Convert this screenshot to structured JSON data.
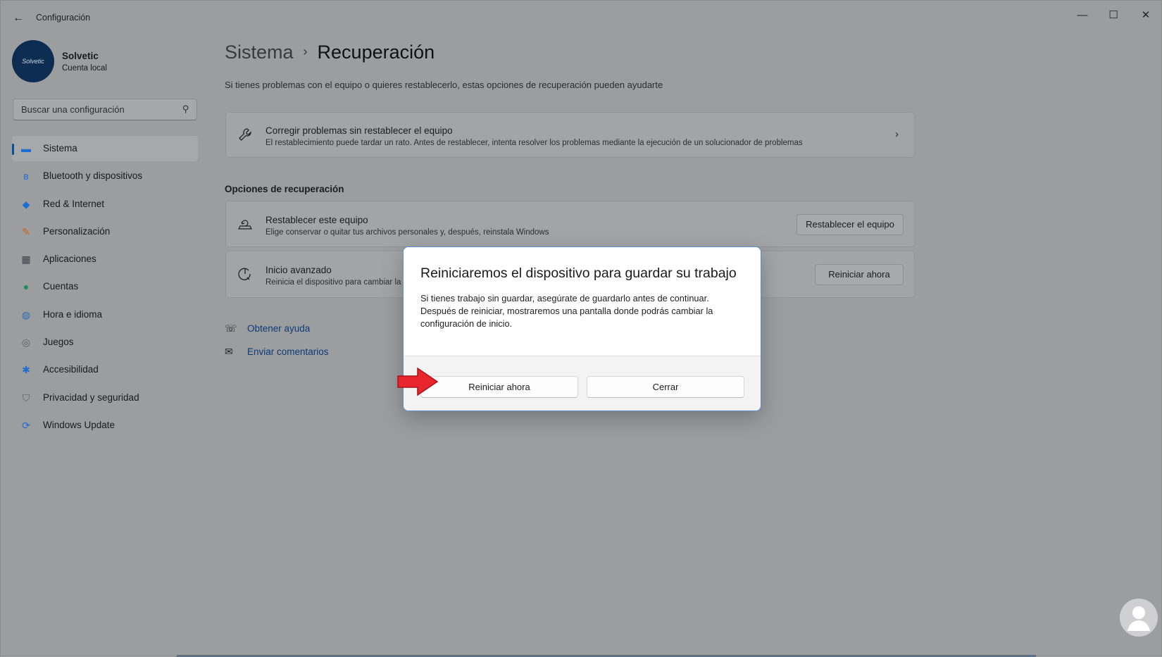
{
  "window": {
    "title": "Configuración",
    "back_glyph": "←",
    "controls": {
      "minimize": "—",
      "maximize": "☐",
      "close": "✕"
    }
  },
  "profile": {
    "avatar_text": "Solvetic",
    "name": "Solvetic",
    "account": "Cuenta local"
  },
  "search": {
    "placeholder": "Buscar una configuración",
    "icon": "search-icon"
  },
  "sidebar": {
    "items": [
      {
        "label": "Sistema",
        "icon": "monitor-icon",
        "glyph": "▬",
        "color": "#1c6fd1",
        "active": true
      },
      {
        "label": "Bluetooth y dispositivos",
        "icon": "bluetooth-icon",
        "glyph": "ʙ",
        "color": "#1c6fd1"
      },
      {
        "label": "Red & Internet",
        "icon": "wifi-icon",
        "glyph": "◆",
        "color": "#1c6fd1"
      },
      {
        "label": "Personalización",
        "icon": "brush-icon",
        "glyph": "✎",
        "color": "#c9621e"
      },
      {
        "label": "Aplicaciones",
        "icon": "apps-icon",
        "glyph": "▦",
        "color": "#3a3f4a"
      },
      {
        "label": "Cuentas",
        "icon": "person-icon",
        "glyph": "●",
        "color": "#1f8f5a"
      },
      {
        "label": "Hora e idioma",
        "icon": "globe-clock-icon",
        "glyph": "◍",
        "color": "#2a6fb3"
      },
      {
        "label": "Juegos",
        "icon": "gamepad-icon",
        "glyph": "◎",
        "color": "#5a5f66"
      },
      {
        "label": "Accesibilidad",
        "icon": "accessibility-icon",
        "glyph": "✱",
        "color": "#1c6fd1"
      },
      {
        "label": "Privacidad y seguridad",
        "icon": "shield-icon",
        "glyph": "⛉",
        "color": "#5a5f66"
      },
      {
        "label": "Windows Update",
        "icon": "update-icon",
        "glyph": "⟳",
        "color": "#1c6fd1"
      }
    ]
  },
  "header": {
    "parent": "Sistema",
    "separator": "›",
    "current": "Recuperación",
    "description": "Si tienes problemas con el equipo o quieres restablecerlo, estas opciones de recuperación pueden ayudarte"
  },
  "troubleshoot_card": {
    "icon": "wrench-icon",
    "title": "Corregir problemas sin restablecer el equipo",
    "description": "El restablecimiento puede tardar un rato. Antes de restablecer, intenta resolver los problemas mediante la ejecución de un solucionador de problemas",
    "chevron": "›"
  },
  "recovery": {
    "section_title": "Opciones de recuperación",
    "reset": {
      "icon": "reset-pc-icon",
      "title": "Restablecer este equipo",
      "description": "Elige conservar o quitar tus archivos personales y, después, reinstala Windows",
      "button": "Restablecer el equipo"
    },
    "advanced": {
      "icon": "advanced-startup-icon",
      "title": "Inicio avanzado",
      "description": "Reinicia el dispositivo para cambiar la",
      "button": "Reiniciar ahora"
    }
  },
  "links": {
    "help": "Obtener ayuda",
    "feedback": "Enviar comentarios"
  },
  "dialog": {
    "title": "Reiniciaremos el dispositivo para guardar su trabajo",
    "body": "Si tienes trabajo sin guardar, asegúrate de guardarlo antes de continuar. Después de reiniciar, mostraremos una pantalla donde podrás cambiar la configuración de inicio.",
    "primary_button": "Reiniciar ahora",
    "secondary_button": "Cerrar"
  },
  "colors": {
    "accent": "#0a4f9e",
    "annotation_arrow": "#e8252c",
    "watermark": "#d9d9dc"
  }
}
